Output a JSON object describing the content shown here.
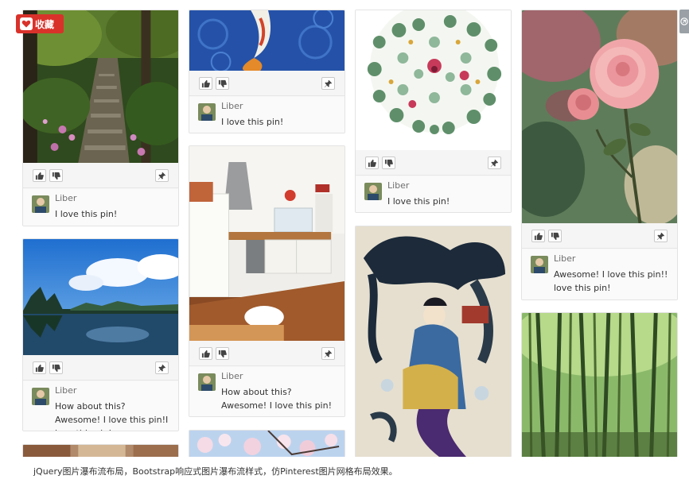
{
  "badge": {
    "label": "收藏",
    "icon": "heart-icon",
    "color": "#d9322b"
  },
  "side_button": {
    "icon": "circle-arrow-icon"
  },
  "icons": {
    "like": "thumbs-up-icon",
    "dislike": "thumbs-down-icon",
    "pin": "pushpin-icon"
  },
  "cards": [
    {
      "image": "forest-stone-stairs",
      "user": "Liber",
      "comment": "I love this pin!"
    },
    {
      "image": "karst-lake-landscape",
      "user": "Liber",
      "comment": "How about this? Awesome! I love this pin!I love this pin!"
    },
    {
      "image": "interior-room",
      "user": "",
      "comment": ""
    },
    {
      "image": "koi-fish-art",
      "user": "Liber",
      "comment": "I love this pin!"
    },
    {
      "image": "white-kitchen",
      "user": "Liber",
      "comment": "How about this? Awesome! I love this pin!"
    },
    {
      "image": "cherry-blossom",
      "user": "",
      "comment": ""
    },
    {
      "image": "flower-sphere",
      "user": "Liber",
      "comment": "I love this pin!"
    },
    {
      "image": "fantasy-illustration",
      "user": "",
      "comment": ""
    },
    {
      "image": "pink-rose",
      "user": "Liber",
      "comment": "Awesome! I love this pin!! love this pin!"
    },
    {
      "image": "bamboo-forest",
      "user": "",
      "comment": ""
    }
  ],
  "caption": "jQuery图片瀑布流布局，Bootstrap响应式图片瀑布流样式，仿Pinterest图片网格布局效果。"
}
